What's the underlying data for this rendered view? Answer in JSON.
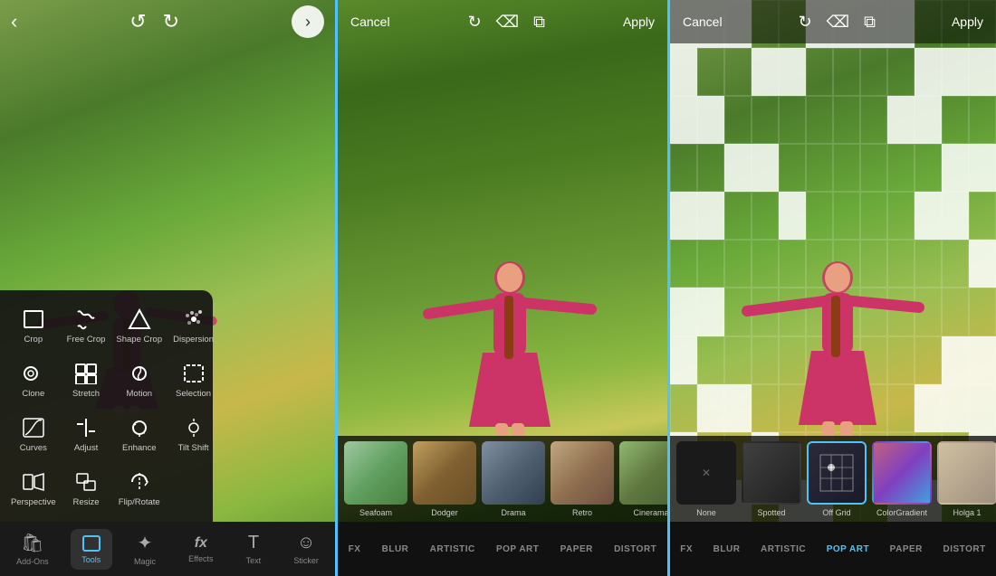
{
  "left": {
    "tools": [
      {
        "id": "crop",
        "label": "Crop",
        "icon": "crop"
      },
      {
        "id": "free-crop",
        "label": "Free Crop",
        "icon": "free-crop"
      },
      {
        "id": "shape-crop",
        "label": "Shape Crop",
        "icon": "shape-crop"
      },
      {
        "id": "dispersion",
        "label": "Dispersion",
        "icon": "dispersion"
      },
      {
        "id": "clone",
        "label": "Clone",
        "icon": "clone"
      },
      {
        "id": "stretch",
        "label": "Stretch",
        "icon": "stretch"
      },
      {
        "id": "motion",
        "label": "Motion",
        "icon": "motion"
      },
      {
        "id": "selection",
        "label": "Selection",
        "icon": "selection"
      },
      {
        "id": "curves",
        "label": "Curves",
        "icon": "curves"
      },
      {
        "id": "adjust",
        "label": "Adjust",
        "icon": "adjust"
      },
      {
        "id": "enhance",
        "label": "Enhance",
        "icon": "enhance"
      },
      {
        "id": "tilt-shift",
        "label": "Tilt Shift",
        "icon": "tilt-shift"
      },
      {
        "id": "perspective",
        "label": "Perspective",
        "icon": "perspective"
      },
      {
        "id": "resize",
        "label": "Resize",
        "icon": "resize"
      },
      {
        "id": "flip-rotate",
        "label": "Flip/Rotate",
        "icon": "flip-rotate"
      }
    ],
    "bottombar": [
      {
        "id": "add-ons",
        "label": "Add-Ons",
        "icon": "bag",
        "active": false
      },
      {
        "id": "tools",
        "label": "Tools",
        "icon": "crop",
        "active": true
      },
      {
        "id": "magic",
        "label": "Magic",
        "icon": "magic",
        "active": false
      },
      {
        "id": "effects",
        "label": "Effects",
        "icon": "fx",
        "active": false
      },
      {
        "id": "text",
        "label": "Text",
        "icon": "text",
        "active": false
      },
      {
        "id": "sticker",
        "label": "Sticker",
        "icon": "sticker",
        "active": false
      }
    ]
  },
  "middle": {
    "cancel_label": "Cancel",
    "apply_label": "Apply",
    "filters": [
      {
        "id": "seafoam",
        "label": "Seafoam",
        "class": "f-seafoam"
      },
      {
        "id": "dodger",
        "label": "Dodger",
        "class": "f-dodger"
      },
      {
        "id": "drama",
        "label": "Drama",
        "class": "f-drama"
      },
      {
        "id": "retro",
        "label": "Retro",
        "class": "f-retro"
      },
      {
        "id": "cinarama",
        "label": "Cinerama",
        "class": "f-cinarama"
      }
    ],
    "tabs": [
      {
        "id": "fx",
        "label": "FX",
        "active": false
      },
      {
        "id": "blur",
        "label": "BLUR",
        "active": false
      },
      {
        "id": "artistic",
        "label": "ARTISTIC",
        "active": false
      },
      {
        "id": "pop-art",
        "label": "POP ART",
        "active": false
      },
      {
        "id": "paper",
        "label": "PAPER",
        "active": false
      },
      {
        "id": "distort",
        "label": "DISTORT",
        "active": false
      }
    ]
  },
  "right": {
    "cancel_label": "Cancel",
    "apply_label": "Apply",
    "filters": [
      {
        "id": "none",
        "label": "None",
        "class": "rf-none",
        "selected": false
      },
      {
        "id": "spotted",
        "label": "Spotted",
        "class": "rf-spotted",
        "selected": false
      },
      {
        "id": "off-grid",
        "label": "Off Grid",
        "class": "rf-offgrid",
        "selected": true
      },
      {
        "id": "colorgradient",
        "label": "ColorGradient",
        "class": "rf-colgrad",
        "selected": false
      },
      {
        "id": "holga1",
        "label": "Holga 1",
        "class": "rf-holga",
        "selected": false
      }
    ],
    "tabs": [
      {
        "id": "fx",
        "label": "FX",
        "active": false
      },
      {
        "id": "blur",
        "label": "BLUR",
        "active": false
      },
      {
        "id": "artistic",
        "label": "ARTISTIC",
        "active": false
      },
      {
        "id": "pop-art",
        "label": "POP ART",
        "active": true
      },
      {
        "id": "paper",
        "label": "PAPER",
        "active": false
      },
      {
        "id": "distort",
        "label": "DISTORT",
        "active": false
      }
    ]
  }
}
